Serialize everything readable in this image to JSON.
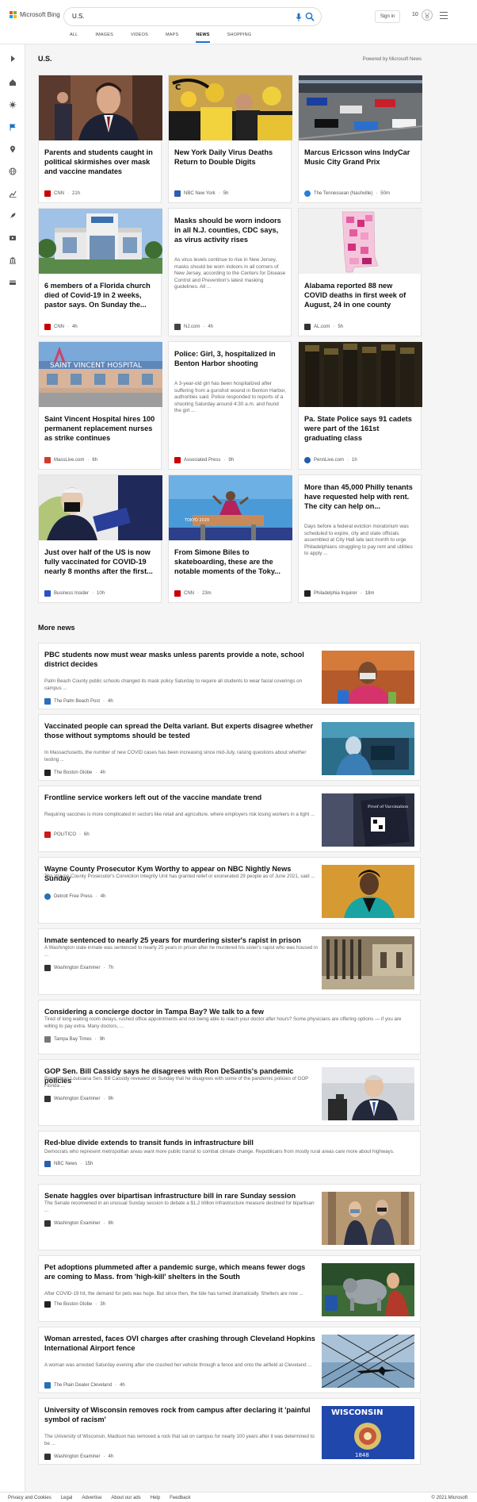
{
  "header": {
    "brand": "Microsoft Bing",
    "query": "U.S.",
    "signin": "Sign in",
    "points": "10",
    "tabs": [
      "ALL",
      "IMAGES",
      "VIDEOS",
      "MAPS",
      "NEWS",
      "SHOPPING"
    ],
    "active_tab": "NEWS"
  },
  "section": {
    "title": "U.S.",
    "powered": "Powered by Microsoft News"
  },
  "cards": [
    {
      "title": "Parents and students caught in political skirmishes over mask and vaccine mandates",
      "desc": "",
      "source": "CNN",
      "time": "21h",
      "logo": "#cc0000",
      "img": "photo-politician"
    },
    {
      "title": "New York Daily Virus Deaths Return to Double Digits",
      "desc": "",
      "source": "NBC New York",
      "time": "5h",
      "logo": "#2b5fb0",
      "img": "photo-crowd-yellow"
    },
    {
      "title": "Marcus Ericsson wins IndyCar Music City Grand Prix",
      "desc": "",
      "source": "The Tennessean (Nashville)",
      "time": "50m",
      "logo": "#2a7fd4",
      "img": "photo-race-cars"
    },
    {
      "title": "6 members of a Florida church died of Covid-19 in 2 weeks, pastor says. On Sunday the...",
      "desc": "",
      "source": "CNN",
      "time": "4h",
      "logo": "#cc0000",
      "img": "photo-church"
    },
    {
      "title": "Masks should be worn indoors in all N.J. counties, CDC says, as virus activity rises",
      "desc": "As virus levels continue to rise in New Jersey, masks should be worn indoors in all corners of New Jersey, according to the Centers for Disease Control and Prevention's latest masking guidelines. All ...",
      "source": "NJ.com",
      "time": "4h",
      "logo": "#444444",
      "img": ""
    },
    {
      "title": "Alabama reported 88 new COVID deaths in first week of August, 24 in one county",
      "desc": "",
      "source": "AL.com",
      "time": "5h",
      "logo": "#333333",
      "img": "map-alabama"
    },
    {
      "title": "Saint Vincent Hospital hires 100 permanent replacement nurses as strike continues",
      "desc": "",
      "source": "MassLive.com",
      "time": "6h",
      "logo": "#d23b2b",
      "img": "photo-hospital"
    },
    {
      "title": "Police: Girl, 3, hospitalized in Benton Harbor shooting",
      "desc": "A 3-year-old girl has been hospitalized after suffering from a gunshot wound in Benton Harbor, authorities said. Police responded to reports of a shooting Saturday around 4:30 a.m. and found the girl ...",
      "source": "Associated Press",
      "time": "9h",
      "logo": "#cc0000",
      "img": ""
    },
    {
      "title": "Pa. State Police says 91 cadets were part of the 161st graduating class",
      "desc": "",
      "source": "PennLive.com",
      "time": "1h",
      "logo": "#1f5fa8",
      "img": "photo-cadets"
    },
    {
      "title": "Just over half of the US is now fully vaccinated for COVID-19 nearly 8 months after the first...",
      "desc": "",
      "source": "Business Insider",
      "time": "10h",
      "logo": "#2a4fc9",
      "img": "photo-vaccine"
    },
    {
      "title": "From Simone Biles to skateboarding, these are the notable moments of the Toky...",
      "desc": "",
      "source": "CNN",
      "time": "23m",
      "logo": "#cc0000",
      "img": "photo-gymnast"
    },
    {
      "title": "More than 45,000 Philly tenants have requested help with rent. The city can help on...",
      "desc": "Days before a federal eviction moratorium was scheduled to expire, city and state officials assembled at City Hall late last month to urge Philadelphians struggling to pay rent and utilities to apply ...",
      "source": "Philadelphia Inquirer",
      "time": "18m",
      "logo": "#222222",
      "img": ""
    }
  ],
  "more_news": {
    "title": "More news",
    "items": [
      {
        "title": "PBC students now must wear masks unless parents provide a note, school district decides",
        "desc": "Palm Beach County public schools changed its mask policy Saturday to require all students to wear facial coverings on campus ...",
        "source": "The Palm Beach Post",
        "time": "4h",
        "logo": "#2a6fb8",
        "thumb": "thumb-student"
      },
      {
        "title": "Vaccinated people can spread the Delta variant. But experts disagree whether those without symptoms should be tested",
        "desc": "In Massachusetts, the number of new COVID cases has been increasing since mid-July, raising questions about whether testing ...",
        "source": "The Boston Globe",
        "time": "4h",
        "logo": "#222222",
        "thumb": "thumb-testing"
      },
      {
        "title": "Frontline service workers left out of the vaccine mandate trend",
        "desc": "Requiring vaccines is more complicated in sectors like retail and agriculture, where employers risk losing workers in a tight ...",
        "source": "POLITICO",
        "time": "6h",
        "logo": "#cc1a1a",
        "thumb": "thumb-sign"
      },
      {
        "title": "Wayne County Prosecutor Kym Worthy to appear on NBC Nightly News Sunday",
        "desc": "The Wayne County Prosecutor's Conviction Integrity Unit has granted relief or exonerated 29 people as of June 2021, said ...",
        "source": "Detroit Free Press",
        "time": "4h",
        "logo": "#2a6fb8",
        "thumb": "thumb-prosecutor"
      },
      {
        "title": "Inmate sentenced to nearly 25 years for murdering sister's rapist in prison",
        "desc": "A Washington state inmate was sentenced to nearly 25 years in prison after he murdered his sister's rapist who was housed in ...",
        "source": "Washington Examiner",
        "time": "7h",
        "logo": "#333333",
        "thumb": "thumb-prison"
      },
      {
        "title": "Considering a concierge doctor in Tampa Bay? We talk to a few",
        "desc": "Tired of long waiting room delays, rushed office appointments and not being able to reach your doctor after hours? Some physicians are offering options — if you are willing to pay extra. Many doctors, ...",
        "source": "Tampa Bay Times",
        "time": "9h",
        "logo": "#777777",
        "thumb": ""
      },
      {
        "title": "GOP Sen. Bill Cassidy says he disagrees with Ron DeSantis's pandemic policies",
        "desc": "Republican Louisiana Sen. Bill Cassidy revealed on Sunday that he disagrees with some of the pandemic policies of GOP Florida ...",
        "source": "Washington Examiner",
        "time": "9h",
        "logo": "#333333",
        "thumb": "thumb-senator"
      },
      {
        "title": "Red-blue divide extends to transit funds in infrastructure bill",
        "desc": "Democrats who represent metropolitan areas want more public transit to combat climate change. Republicans from mostly rural areas care more about highways.",
        "source": "NBC News",
        "time": "15h",
        "logo": "#2b5fb0",
        "thumb": ""
      },
      {
        "title": "Senate haggles over bipartisan infrastructure bill in rare Sunday session",
        "desc": "The Senate reconvened in an unusual Sunday session to debate a $1.2 trillion infrastructure measure destined for bipartisan ...",
        "source": "Washington Examiner",
        "time": "8h",
        "logo": "#333333",
        "thumb": "thumb-senate"
      },
      {
        "title": "Pet adoptions plummeted after a pandemic surge, which means fewer dogs are coming to Mass. from 'high-kill' shelters in the South",
        "desc": "After COVID-19 hit, the demand for pets was huge. But since then, the tide has turned dramatically. Shelters are now ...",
        "source": "The Boston Globe",
        "time": "3h",
        "logo": "#222222",
        "thumb": "thumb-dogs"
      },
      {
        "title": "Woman arrested, faces OVI charges after crashing through Cleveland Hopkins International Airport fence",
        "desc": "A woman was arrested Saturday evening after she crashed her vehicle through a fence and onto the airfield at Cleveland ...",
        "source": "The Plain Dealer Cleveland",
        "time": "4h",
        "logo": "#2a6fb8",
        "thumb": "thumb-plane"
      },
      {
        "title": "University of Wisconsin removes rock from campus after declaring it 'painful symbol of racism'",
        "desc": "The University of Wisconsin, Madison has removed a rock that sat on campus for nearly 100 years after it was determined to be ...",
        "source": "Washington Examiner",
        "time": "4h",
        "logo": "#333333",
        "thumb": "thumb-flag"
      }
    ]
  },
  "footer": {
    "links": [
      "Privacy and Cookies",
      "Legal",
      "Advertise",
      "About our ads",
      "Help",
      "Feedback"
    ],
    "copyright": "© 2021 Microsoft"
  },
  "colors": {
    "accent": "#1a73c8",
    "bing_red": "#f25022",
    "bing_green": "#7fba00",
    "bing_blue": "#00a4ef",
    "bing_yellow": "#ffb900"
  }
}
